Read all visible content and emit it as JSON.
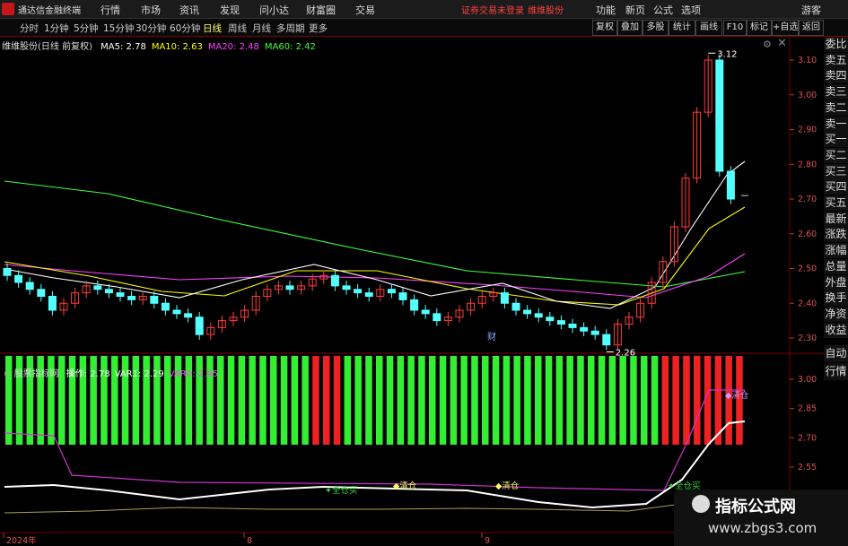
{
  "app": {
    "title": "通达信金融终端",
    "login_warning": "证券交易未登录",
    "stock_link": "维维股份",
    "guest": "游客"
  },
  "menu": [
    "行情",
    "市场",
    "资讯",
    "发现",
    "问小达",
    "财富圈",
    "交易"
  ],
  "right_menu": [
    "功能",
    "新页",
    "公式",
    "选项"
  ],
  "periods": [
    "分时",
    "1分钟",
    "5分钟",
    "15分钟",
    "30分钟",
    "60分钟",
    "日线",
    "周线",
    "月线",
    "多周期",
    "更多"
  ],
  "active_period": "日线",
  "toolbar_right": [
    "复权",
    "叠加",
    "多股",
    "统计",
    "画线",
    "F10",
    "标记",
    "+自选",
    "返回"
  ],
  "chart_header": {
    "name": "维维股份(日线 前复权)",
    "ma": [
      {
        "label": "MA5: 2.78",
        "color": "#ffffff"
      },
      {
        "label": "MA10: 2.63",
        "color": "#ffff00"
      },
      {
        "label": "MA20: 2.48",
        "color": "#ff40ff"
      },
      {
        "label": "MA60: 2.42",
        "color": "#40ff40"
      }
    ]
  },
  "price_axis": [
    "3.10",
    "3.00",
    "2.90",
    "2.80",
    "2.70",
    "2.60",
    "2.50",
    "2.40",
    "2.30"
  ],
  "price_annotations": {
    "high": "3.12",
    "low": "2.26",
    "event": "财"
  },
  "side_buttons_top": [
    "委比",
    "卖五",
    "卖四",
    "卖三",
    "卖二",
    "卖一",
    "买一",
    "买二",
    "买三",
    "买四",
    "买五",
    "最新",
    "涨跌",
    "涨幅",
    "总量",
    "外盘",
    "换手",
    "净资",
    "收益"
  ],
  "side_buttons_bottom": [
    "自动",
    "行情"
  ],
  "indicator": {
    "name": "股票指标网",
    "values": [
      {
        "label": "操作: 2.78",
        "color": "#ffffff"
      },
      {
        "label": "VAR1: 2.29",
        "color": "#ffffff"
      },
      {
        "label": "VAR0: 2.95",
        "color": "#ff40ff"
      }
    ],
    "axis": [
      "3.00",
      "2.85",
      "2.70",
      "2.55"
    ],
    "signals": [
      "全仓买",
      "清仓",
      "清仓",
      "全仓买",
      "清仓"
    ]
  },
  "date_axis": [
    "2024年",
    "8",
    "9"
  ],
  "watermark": {
    "title": "指标公式网",
    "url": "www.zbgs3.com"
  },
  "colors": {
    "up": "#ff3c3c",
    "down": "#54ffff",
    "bar_green": "#33ee33",
    "bar_red": "#ee2222"
  }
}
